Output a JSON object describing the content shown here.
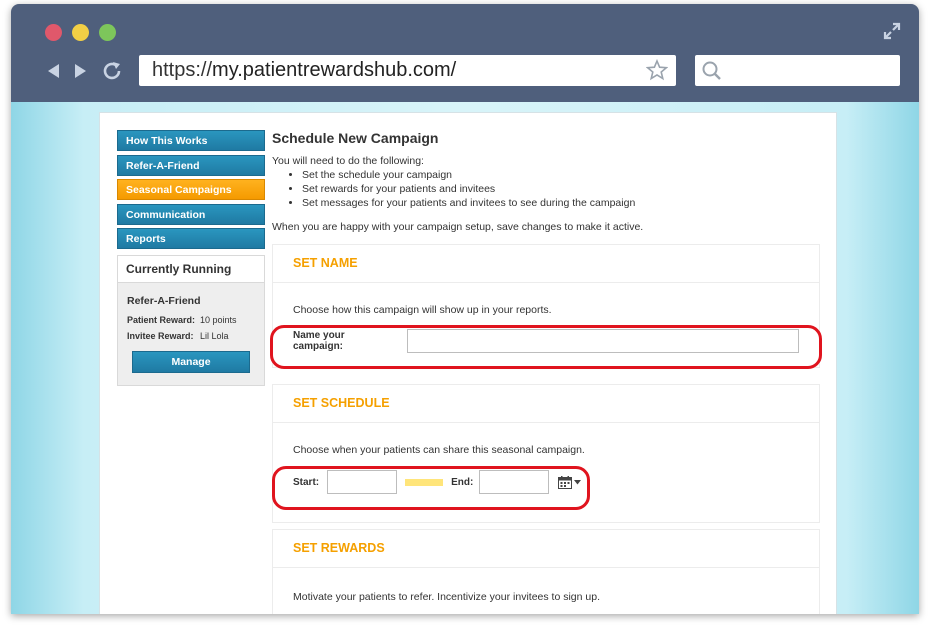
{
  "browser": {
    "url_protocol": "https://",
    "url_host": "my.patientrewardshub.com/",
    "colors": {
      "close": "#e0586b",
      "minimize": "#f2cf45",
      "maximize": "#7dc65b"
    }
  },
  "sidebar": {
    "items": [
      {
        "label": "How This Works"
      },
      {
        "label": "Refer-A-Friend"
      },
      {
        "label": "Seasonal Campaigns"
      },
      {
        "label": "Communication"
      },
      {
        "label": "Reports"
      }
    ],
    "running": {
      "title": "Currently Running",
      "name": "Refer-A-Friend",
      "patient_label": "Patient Reward:",
      "patient_value": "10 points",
      "invitee_label": "Invitee Reward:",
      "invitee_value": "Lil Lola",
      "manage": "Manage"
    }
  },
  "main": {
    "title": "Schedule New Campaign",
    "intro": "You will need to do the following:",
    "steps": [
      "Set the schedule your campaign",
      "Set rewards for your patients and invitees",
      "Set messages for your patients and invitees to see during the campaign"
    ],
    "outro": "When you are happy with your campaign setup, save changes to make it active.",
    "set_name": {
      "heading": "SET NAME",
      "desc": "Choose how this campaign will show up in your reports.",
      "label": "Name your campaign:",
      "value": ""
    },
    "set_schedule": {
      "heading": "SET SCHEDULE",
      "desc": "Choose when your patients can share this seasonal campaign.",
      "start_label": "Start:",
      "end_label": "End:"
    },
    "set_rewards": {
      "heading": "SET REWARDS",
      "desc": "Motivate your patients to refer. Incentivize your invitees to sign up."
    }
  },
  "colors": {
    "accent": "#f5a000",
    "nav_blue": "#2a96bf",
    "nav_active": "#ffb21f",
    "highlight": "#e0141e"
  }
}
